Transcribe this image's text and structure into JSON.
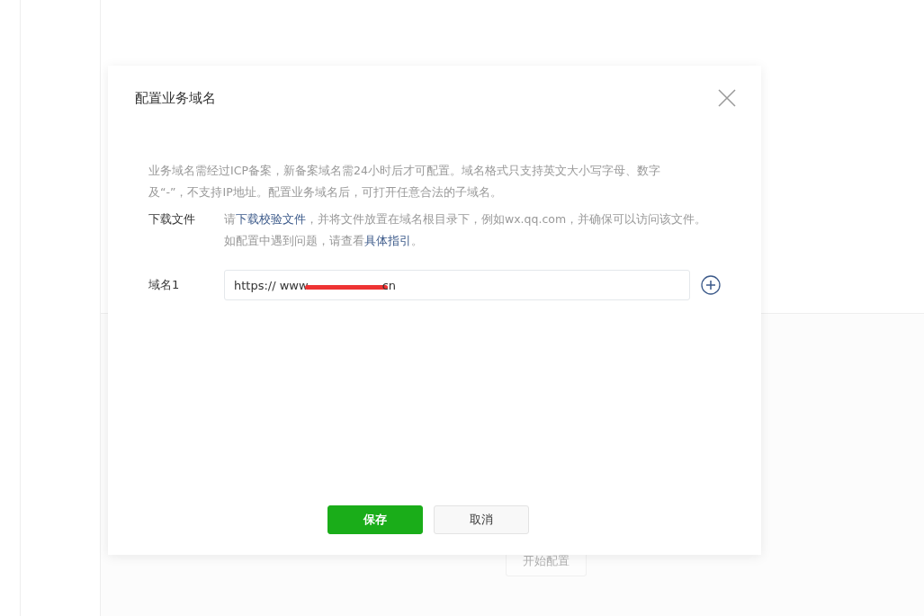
{
  "background": {
    "button": "开始配置"
  },
  "dialog": {
    "title": "配置业务域名",
    "notice": "业务域名需经过ICP备案，新备案域名需24小时后才可配置。域名格式只支持英文大小写字母、数字及“-”，不支持IP地址。配置业务域名后，可打开任意合法的子域名。",
    "download": {
      "label": "下载文件",
      "text_before": "请",
      "link": "下载校验文件",
      "text_middle": "，并将文件放置在域名根目录下，例如wx.qq.com，并确保可以访问该文件。如配置中遇到问题，请查看",
      "link2": "具体指引",
      "text_after": "。"
    },
    "domains": [
      {
        "label": "域名1",
        "value_start": "https:// www",
        "value_end": "cn"
      }
    ],
    "buttons": [
      {
        "label": "保存",
        "kind": "primary"
      },
      {
        "label": "取消",
        "kind": "default"
      }
    ]
  }
}
